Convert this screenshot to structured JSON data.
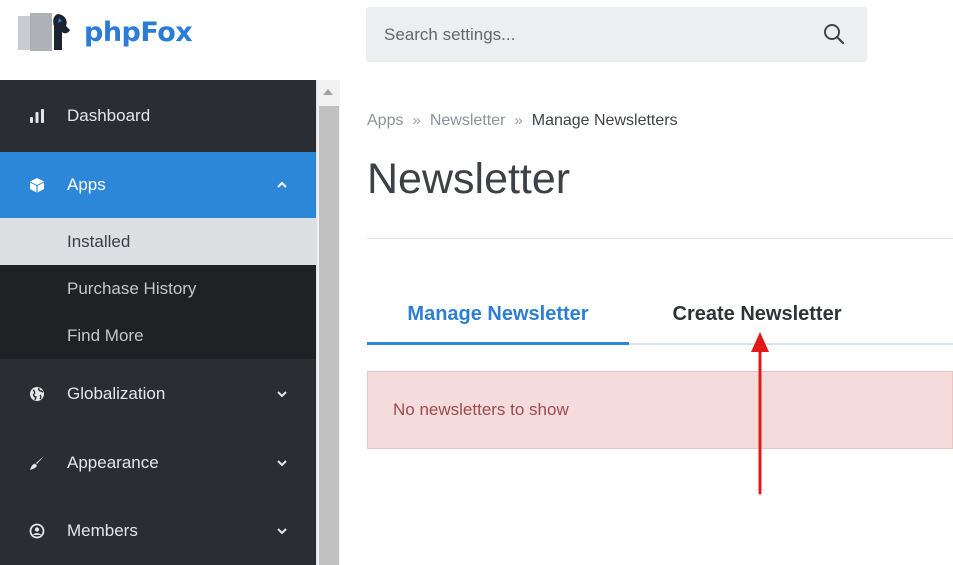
{
  "header": {
    "logo_text": "phpFox",
    "search_placeholder": "Search settings..."
  },
  "sidebar": {
    "items": [
      {
        "label": "Dashboard",
        "icon": "bar-chart-icon"
      },
      {
        "label": "Apps",
        "icon": "cube-icon",
        "expanded": true
      },
      {
        "label": "Globalization",
        "icon": "globe-icon"
      },
      {
        "label": "Appearance",
        "icon": "brush-icon"
      },
      {
        "label": "Members",
        "icon": "user-circle-icon"
      }
    ],
    "apps_sub_items": [
      {
        "label": "Installed",
        "active": true
      },
      {
        "label": "Purchase History"
      },
      {
        "label": "Find More"
      }
    ]
  },
  "breadcrumb": {
    "items": [
      "Apps",
      "Newsletter"
    ],
    "current": "Manage Newsletters"
  },
  "page": {
    "title": "Newsletter"
  },
  "tabs": [
    {
      "label": "Manage Newsletter",
      "active": true
    },
    {
      "label": "Create Newsletter",
      "active": false
    }
  ],
  "alert": {
    "text": "No newsletters to show"
  },
  "colors": {
    "accent": "#2d87d8",
    "sidebar_bg": "#2a2d31",
    "alert_bg": "#f4dcdd",
    "annotation": "#e0191b"
  }
}
